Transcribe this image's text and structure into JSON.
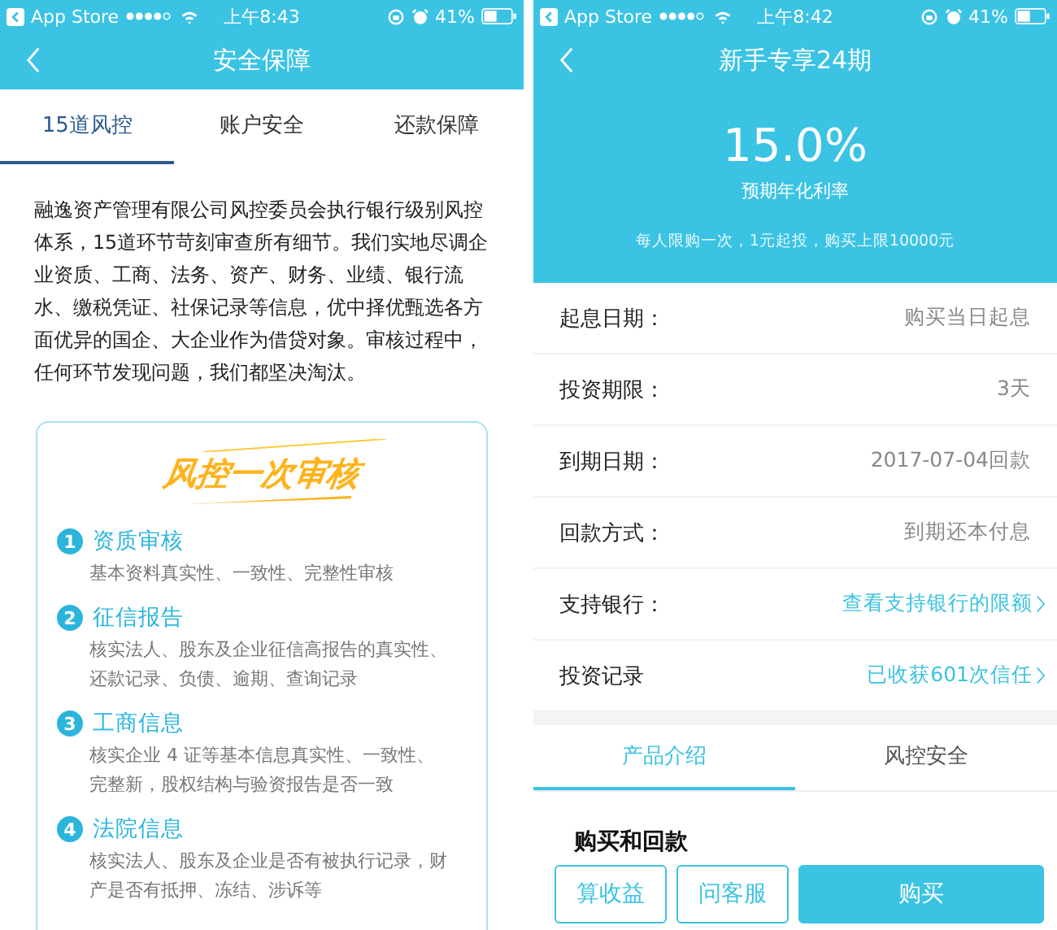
{
  "left_screen": {
    "status_bar": {
      "back_app": "App Store",
      "time": "上午8:43",
      "battery": "41%"
    },
    "nav": {
      "title": "安全保障"
    },
    "tabs": [
      {
        "label": "15道风控",
        "selected": true
      },
      {
        "label": "账户安全",
        "selected": false
      },
      {
        "label": "还款保障",
        "selected": false
      }
    ],
    "intro": "融逸资产管理有限公司风控委员会执行银行级别风控体系，15道环节苛刻审查所有细节。我们实地尽调企业资质、工商、法务、资产、财务、业绩、银行流水、缴税凭证、社保记录等信息，优中择优甄选各方面优异的国企、大企业作为借贷对象。审核过程中，任何环节发现问题，我们都坚决淘汰。",
    "card": {
      "title": "风控一次审核",
      "steps": [
        {
          "number": "1",
          "title": "资质审核",
          "description": "基本资料真实性、一致性、完整性审核"
        },
        {
          "number": "2",
          "title": "征信报告",
          "description": "核实法人、股东及企业征信高报告的真实性、还款记录、负债、逾期、查询记录"
        },
        {
          "number": "3",
          "title": "工商信息",
          "description": "核实企业 4 证等基本信息真实性、一致性、完整新，股权结构与验资报告是否一致"
        },
        {
          "number": "4",
          "title": "法院信息",
          "description": "核实法人、股东及企业是否有被执行记录，财产是否有抵押、冻结、涉诉等"
        }
      ]
    }
  },
  "right_screen": {
    "status_bar": {
      "back_app": "App Store",
      "time": "上午8:42",
      "battery": "41%"
    },
    "nav": {
      "title": "新手专享24期"
    },
    "rate": "15.0%",
    "rate_label": "预期年化利率",
    "limits": "每人限购一次，1元起投，购买上限10000元",
    "details": [
      {
        "label": "起息日期：",
        "value": "购买当日起息",
        "kind": "text"
      },
      {
        "label": "投资期限：",
        "value": "3天",
        "kind": "text"
      },
      {
        "label": "到期日期：",
        "value": "2017-07-04回款",
        "kind": "text"
      },
      {
        "label": "回款方式：",
        "value": "到期还本付息",
        "kind": "text"
      },
      {
        "label": "支持银行：",
        "value": "查看支持银行的限额",
        "kind": "link"
      },
      {
        "label": "投资记录",
        "value": "已收获601次信任",
        "kind": "link"
      }
    ],
    "tabs": [
      {
        "label": "产品介绍",
        "selected": true
      },
      {
        "label": "风控安全",
        "selected": false
      }
    ],
    "section_heading": "购买和回款",
    "buttons": [
      {
        "label": "算收益",
        "kind": "outline"
      },
      {
        "label": "问客服",
        "kind": "outline"
      },
      {
        "label": "购买",
        "kind": "primary"
      }
    ]
  }
}
